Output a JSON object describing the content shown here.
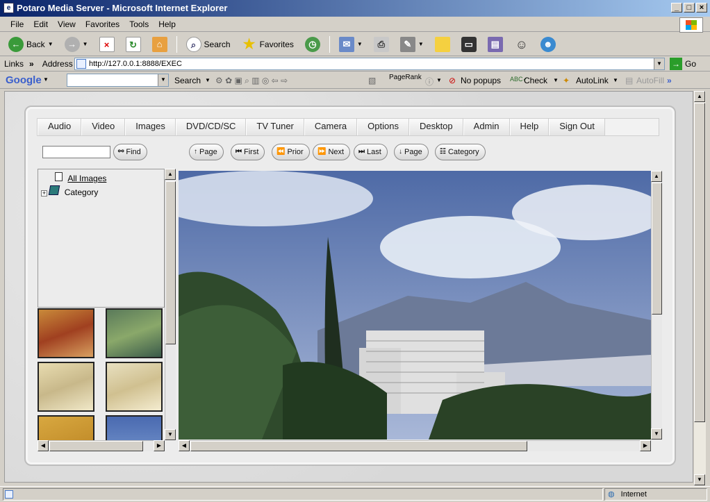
{
  "window": {
    "title": "Potaro Media Server - Microsoft Internet Explorer"
  },
  "menubar": {
    "items": [
      "File",
      "Edit",
      "View",
      "Favorites",
      "Tools",
      "Help"
    ]
  },
  "toolbar": {
    "back": "Back",
    "search": "Search",
    "favorites": "Favorites"
  },
  "addressbar": {
    "links_label": "Links",
    "address_label": "Address",
    "url": "http://127.0.0.1:8888/EXEC",
    "go_label": "Go"
  },
  "googlebar": {
    "brand": "Google",
    "search": "Search",
    "pagerank": "PageRank",
    "popups": "No popups",
    "check": "Check",
    "autolink": "AutoLink",
    "autofill": "AutoFill"
  },
  "app": {
    "tabs": [
      "Audio",
      "Video",
      "Images",
      "DVD/CD/SC",
      "TV Tuner",
      "Camera",
      "Options",
      "Desktop",
      "Admin",
      "Help",
      "Sign Out"
    ],
    "find_label": "Find",
    "nav": {
      "page_up": "Page",
      "first": "First",
      "prior": "Prior",
      "next": "Next",
      "last": "Last",
      "page_down": "Page",
      "category": "Category"
    },
    "tree": {
      "all_images": "All Images",
      "category": "Category"
    }
  },
  "statusbar": {
    "zone": "Internet"
  },
  "colors": {
    "title_gradient_start": "#0a246a",
    "title_gradient_end": "#a6caf0",
    "chrome": "#d4d0c8"
  }
}
